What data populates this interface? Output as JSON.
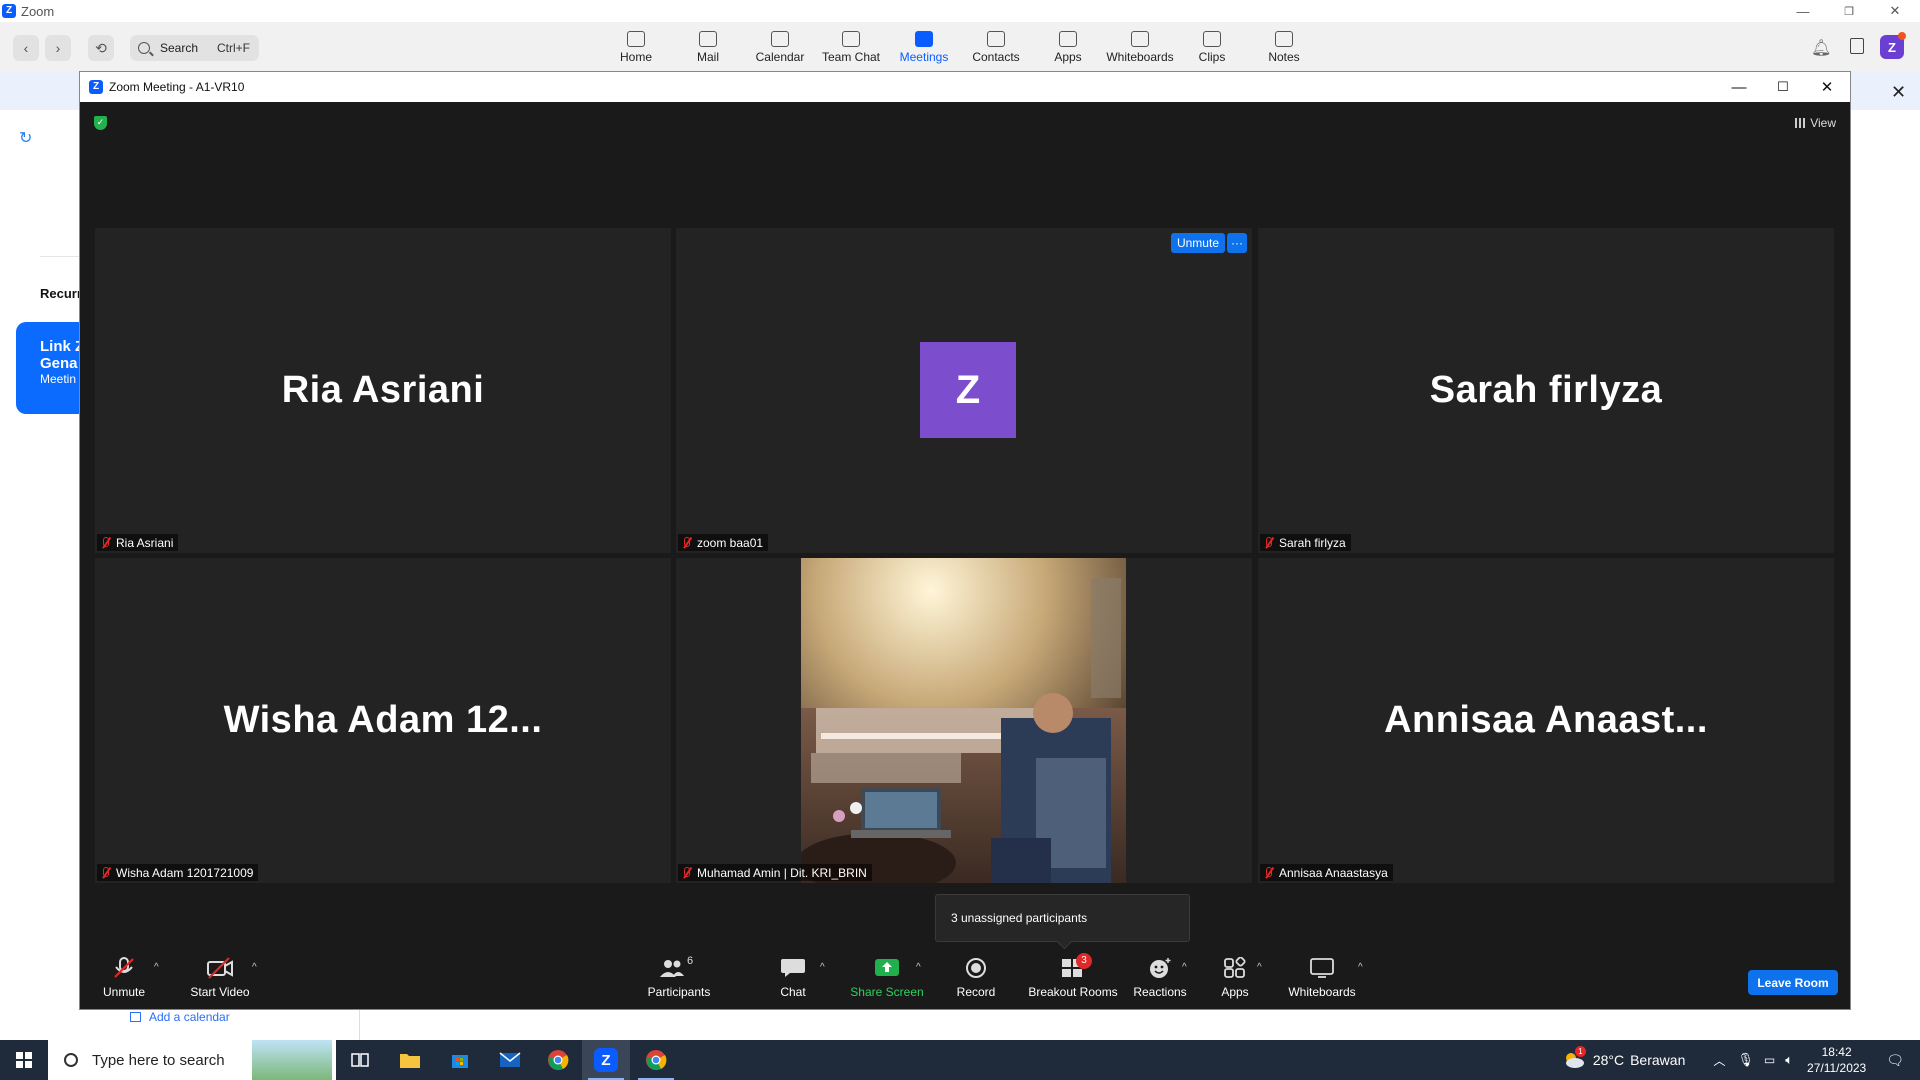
{
  "app": {
    "title": "Zoom",
    "search_label": "Search",
    "search_shortcut": "Ctrl+F",
    "tabs": [
      {
        "label": "Home",
        "icon": "home-icon"
      },
      {
        "label": "Mail",
        "icon": "mail-icon"
      },
      {
        "label": "Calendar",
        "icon": "calendar-icon"
      },
      {
        "label": "Team Chat",
        "icon": "chat-bubble-icon"
      },
      {
        "label": "Meetings",
        "icon": "video-camera-icon",
        "active": true
      },
      {
        "label": "Contacts",
        "icon": "contacts-icon"
      },
      {
        "label": "Apps",
        "icon": "apps-icon"
      },
      {
        "label": "Whiteboards",
        "icon": "whiteboard-icon"
      },
      {
        "label": "Clips",
        "icon": "clips-icon"
      },
      {
        "label": "Notes",
        "icon": "notes-icon"
      }
    ],
    "avatar_letter": "Z"
  },
  "background_page": {
    "recurring_label": "Recurr",
    "card_line1": "Link Z",
    "card_line2": "Gena",
    "card_line3": "Meetin",
    "add_calendar": "Add a calendar"
  },
  "meeting": {
    "window_title": "Zoom Meeting - A1-VR10",
    "view_label": "View",
    "tiles": [
      {
        "display_name": "Ria Asriani",
        "name_tag": "Ria Asriani",
        "kind": "name"
      },
      {
        "display_name": "Z",
        "name_tag": "zoom baa01",
        "kind": "avatar",
        "unmute_label": "Unmute",
        "more_label": "···"
      },
      {
        "display_name": "Sarah firlyza",
        "name_tag": "Sarah firlyza",
        "kind": "name"
      },
      {
        "display_name": "Wisha  Adam  12...",
        "name_tag": "Wisha Adam 1201721009",
        "kind": "name"
      },
      {
        "display_name": "",
        "name_tag": "Muhamad Amin | Dit. KRI_BRIN",
        "kind": "video"
      },
      {
        "display_name": "Annisaa  Anaast...",
        "name_tag": "Annisaa Anaastasya",
        "kind": "name"
      }
    ],
    "tooltip": "3 unassigned participants",
    "toolbar": {
      "unmute": "Unmute",
      "start_video": "Start Video",
      "participants": "Participants",
      "participants_count": "6",
      "chat": "Chat",
      "share_screen": "Share Screen",
      "record": "Record",
      "breakout_rooms": "Breakout Rooms",
      "breakout_badge": "3",
      "reactions": "Reactions",
      "apps": "Apps",
      "whiteboards": "Whiteboards",
      "leave_room": "Leave Room"
    },
    "colors": {
      "accent": "#0e72ed",
      "muted_red": "#e02828",
      "share_green": "#20b14c",
      "avatar_purple": "#7c4dcc"
    }
  },
  "taskbar": {
    "search_placeholder": "Type here to search",
    "weather_temp": "28°C",
    "weather_desc": "Berawan",
    "weather_badge": "1",
    "time": "18:42",
    "date": "27/11/2023"
  }
}
